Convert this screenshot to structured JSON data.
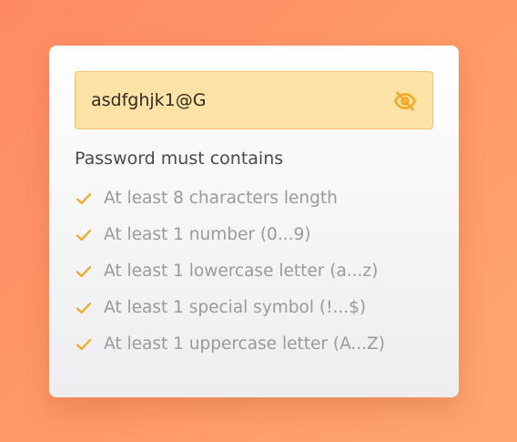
{
  "password": {
    "value": "asdfghjk1@G",
    "toggle_icon": "eye-off-icon"
  },
  "requirements": {
    "heading": "Password must contains",
    "items": [
      {
        "label": "At least 8 characters length",
        "met": true
      },
      {
        "label": "At least 1 number (0...9)",
        "met": true
      },
      {
        "label": "At least 1 lowercase letter (a...z)",
        "met": true
      },
      {
        "label": "At least 1 special symbol (!...$)",
        "met": true
      },
      {
        "label": "At least 1 uppercase letter (A...Z)",
        "met": true
      }
    ]
  },
  "colors": {
    "accent": "#F5A623",
    "input_bg": "#FFE2A6",
    "input_border": "#F4C067",
    "requirement_text": "#9A9A9A",
    "heading_text": "#4A4A4A",
    "background": "#FF9966"
  }
}
